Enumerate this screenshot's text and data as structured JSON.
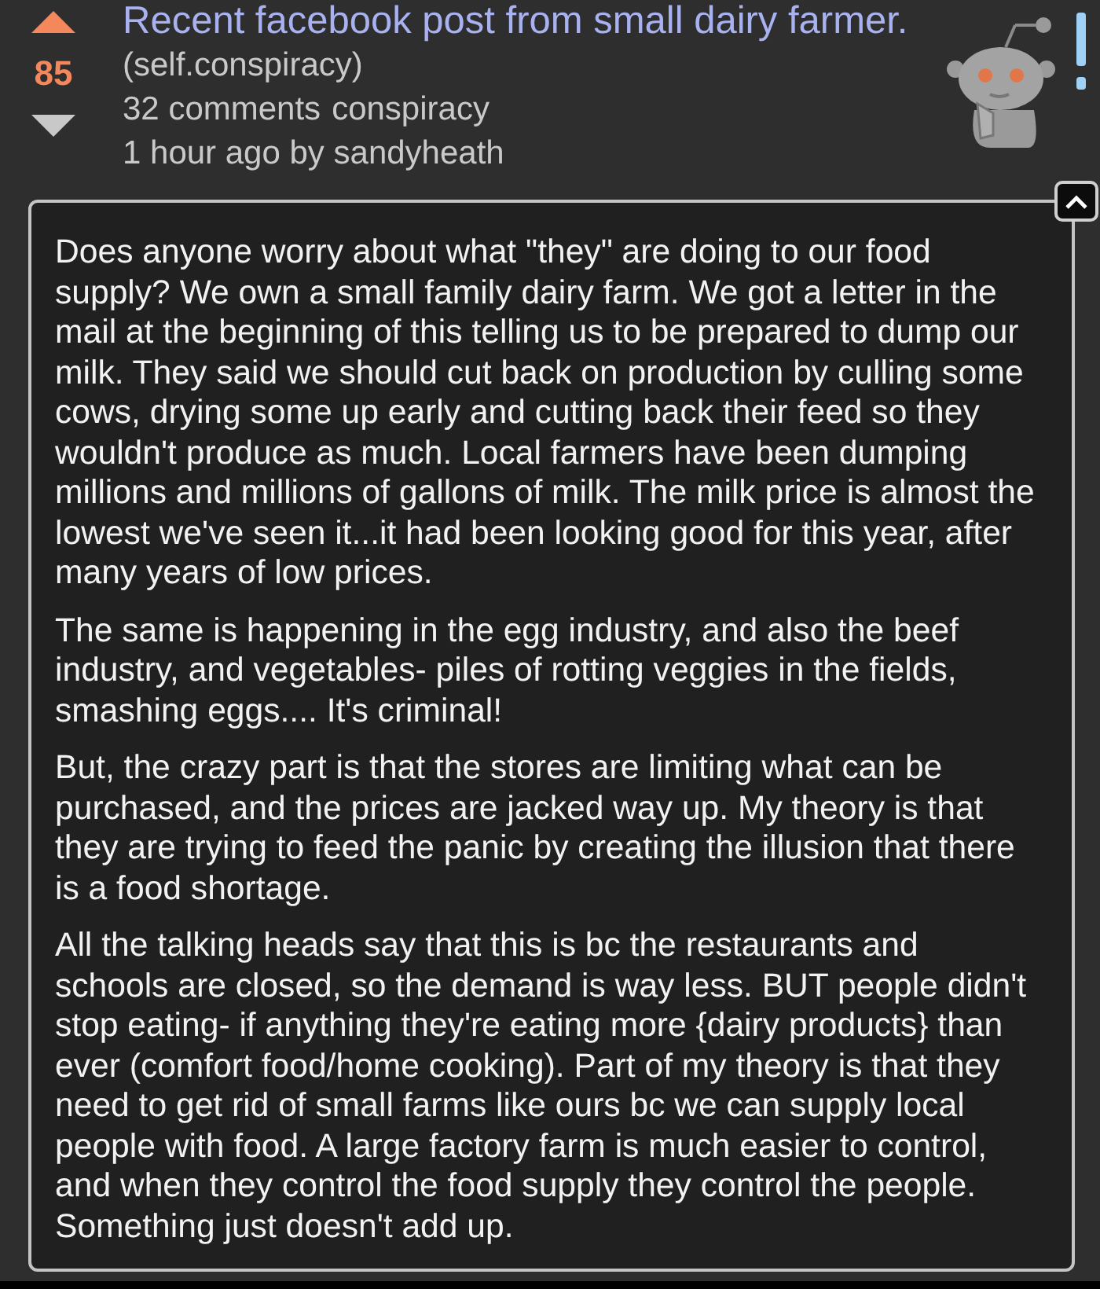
{
  "post": {
    "vote": {
      "upvoted": true,
      "downvoted": false,
      "score": "85"
    },
    "title": "Recent facebook post from small dairy farmer.",
    "domain": "(self.conspiracy)",
    "comments": "32 comments",
    "subreddit": "conspiracy",
    "byline": "1 hour ago by sandyheath"
  },
  "body": {
    "expanded": true,
    "paragraphs": [
      "Does anyone worry about what \"they\" are doing to our food supply? We own a small family dairy farm. We got a letter in the mail at the beginning of this telling us to be prepared to dump our milk. They said we should cut back on production by culling some cows, drying some up early and cutting back their feed so they wouldn't produce as much. Local farmers have been dumping millions and millions of gallons of milk. The milk price is almost the lowest we've seen it...it had been looking good for this year, after many years of low prices.",
      "The same is happening in the egg industry, and also the beef industry, and vegetables- piles of rotting veggies in the fields, smashing eggs.... It's criminal!",
      "But, the crazy part is that the stores are limiting what can be purchased, and the prices are jacked way up. My theory is that they are trying to feed the panic by creating the illusion that there is a food shortage.",
      "All the talking heads say that this is bc the restaurants and schools are closed, so the demand is way less. BUT people didn't stop eating- if anything they're eating more {dairy products} than ever (comfort food/home cooking). Part of my theory is that they need to get rid of small farms like ours bc we can supply local people with food. A large factory farm is much easier to control, and when they control the food supply they control the people. Something just doesn't add up."
    ]
  }
}
